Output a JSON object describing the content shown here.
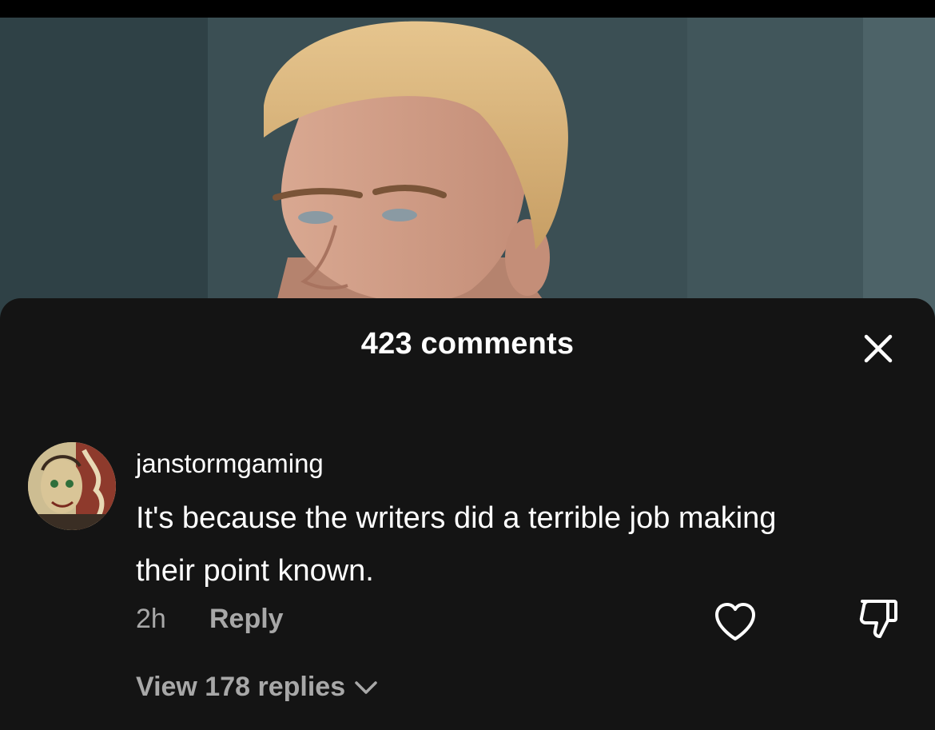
{
  "comments_sheet": {
    "title": "423 comments",
    "close_icon": "close-icon"
  },
  "comment": {
    "username": "janstormgaming",
    "text": "It's because the writers did a terrible job making their point known.",
    "time": "2h",
    "reply_label": "Reply",
    "view_replies_label": "View 178 replies",
    "icons": {
      "like": "heart-icon",
      "dislike": "thumbs-down-icon",
      "expand": "chevron-down-icon"
    }
  },
  "colors": {
    "sheet_background": "#141414",
    "primary_text": "#ffffff",
    "secondary_text": "#a8a8a8"
  }
}
